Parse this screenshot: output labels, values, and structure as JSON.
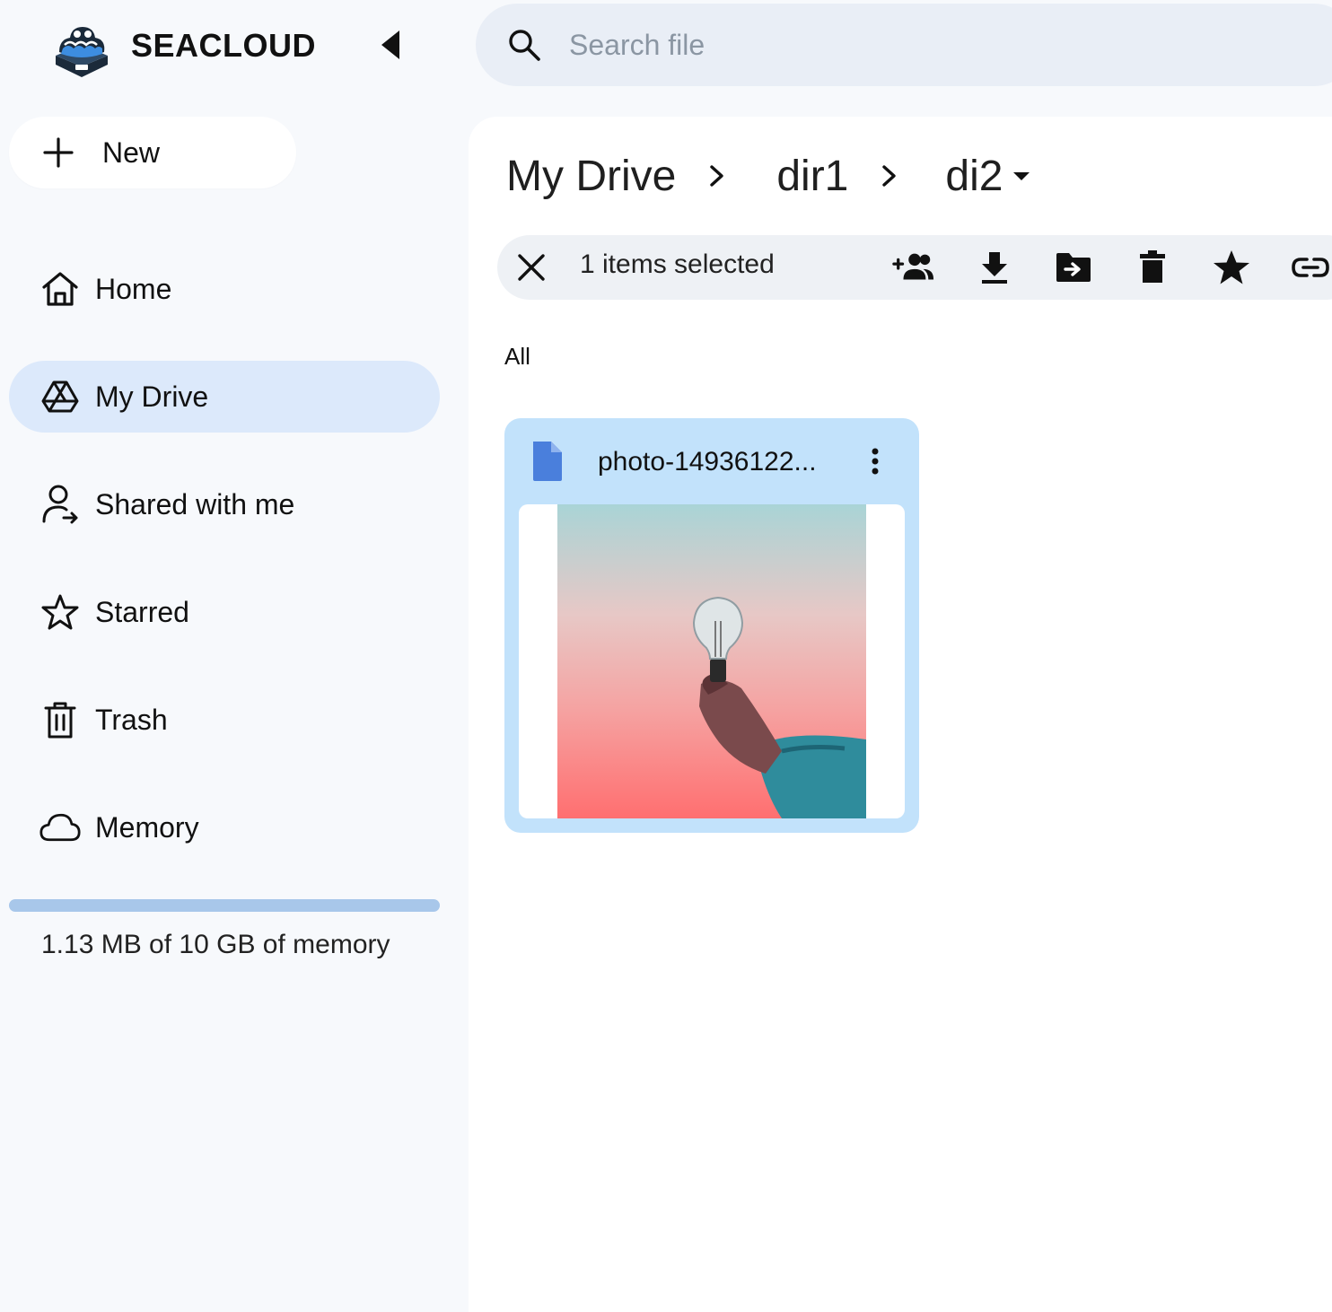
{
  "brand": {
    "name": "SEACLOUD"
  },
  "search": {
    "placeholder": "Search file"
  },
  "new_button": {
    "label": "New"
  },
  "sidebar": {
    "items": [
      {
        "label": "Home",
        "icon": "home-icon",
        "active": false
      },
      {
        "label": "My Drive",
        "icon": "drive-icon",
        "active": true
      },
      {
        "label": "Shared with me",
        "icon": "shared-person-icon",
        "active": false
      },
      {
        "label": "Starred",
        "icon": "star-outline-icon",
        "active": false
      },
      {
        "label": "Trash",
        "icon": "trash-icon",
        "active": false
      },
      {
        "label": "Memory",
        "icon": "cloud-icon",
        "active": false
      }
    ]
  },
  "storage": {
    "text": "1.13 MB of 10 GB of memory",
    "used_fraction": 0.0001
  },
  "breadcrumb": {
    "items": [
      "My Drive",
      "dir1",
      "di2"
    ]
  },
  "selection": {
    "count_text": "1 items selected",
    "tools": [
      "add-people-icon",
      "download-icon",
      "move-to-folder-icon",
      "delete-icon",
      "star-icon",
      "link-icon"
    ]
  },
  "section": {
    "label": "All"
  },
  "files": [
    {
      "name": "photo-14936122...",
      "type_icon": "document-icon"
    }
  ],
  "colors": {
    "accent_active": "#dce9fb",
    "card": "#c2e2fb",
    "file_icon": "#4a7fdc",
    "storage_bar": "#a8c7ea"
  }
}
